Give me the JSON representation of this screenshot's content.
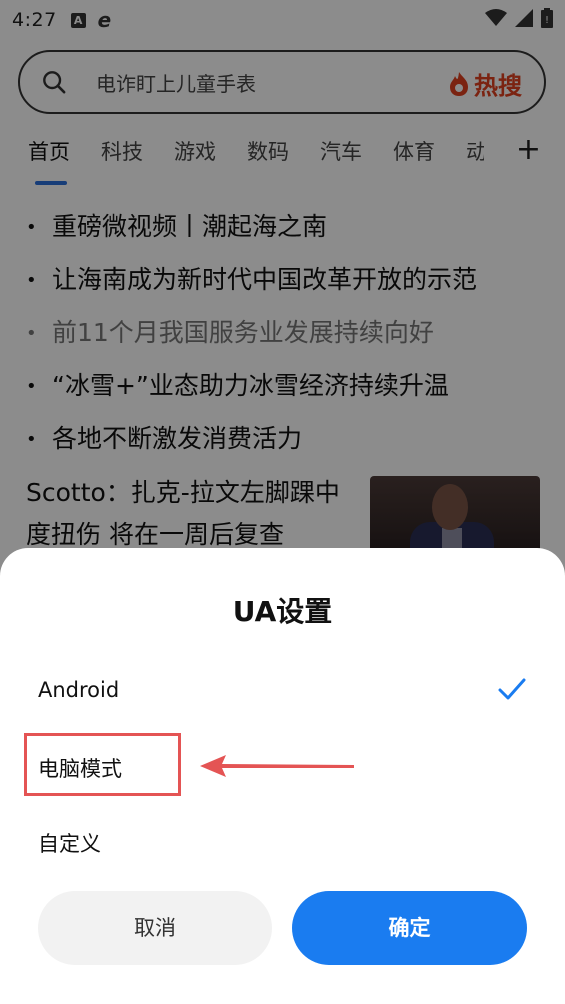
{
  "status_bar": {
    "time": "4:27",
    "icons": [
      "a-badge-icon",
      "e-browser-icon",
      "wifi-icon",
      "signal-icon",
      "battery-icon"
    ],
    "a_label": "A",
    "e_label": "e"
  },
  "search": {
    "placeholder": "电诈盯上儿童手表",
    "hot_label": "热搜"
  },
  "tabs": [
    "首页",
    "科技",
    "游戏",
    "数码",
    "汽车",
    "体育",
    "动"
  ],
  "news": [
    {
      "text": "重磅微视频丨潮起海之南",
      "read": false
    },
    {
      "text": "让海南成为新时代中国改革开放的示范",
      "read": false
    },
    {
      "text": "前11个月我国服务业发展持续向好",
      "read": true
    },
    {
      "text": "“冰雪+”业态助力冰雪经济持续升温",
      "read": false
    },
    {
      "text": "各地不断激发消费活力",
      "read": false
    }
  ],
  "card": {
    "title": "Scotto：扎克-拉文左脚踝中度扭伤 将在一周后复查"
  },
  "dialog": {
    "title": "UA设置",
    "options": [
      "Android",
      "电脑模式",
      "自定义"
    ],
    "selected": "Android",
    "cancel_label": "取消",
    "confirm_label": "确定"
  },
  "colors": {
    "accent": "#1a7cf0",
    "highlight": "#e45454",
    "hot": "#e0411f"
  }
}
